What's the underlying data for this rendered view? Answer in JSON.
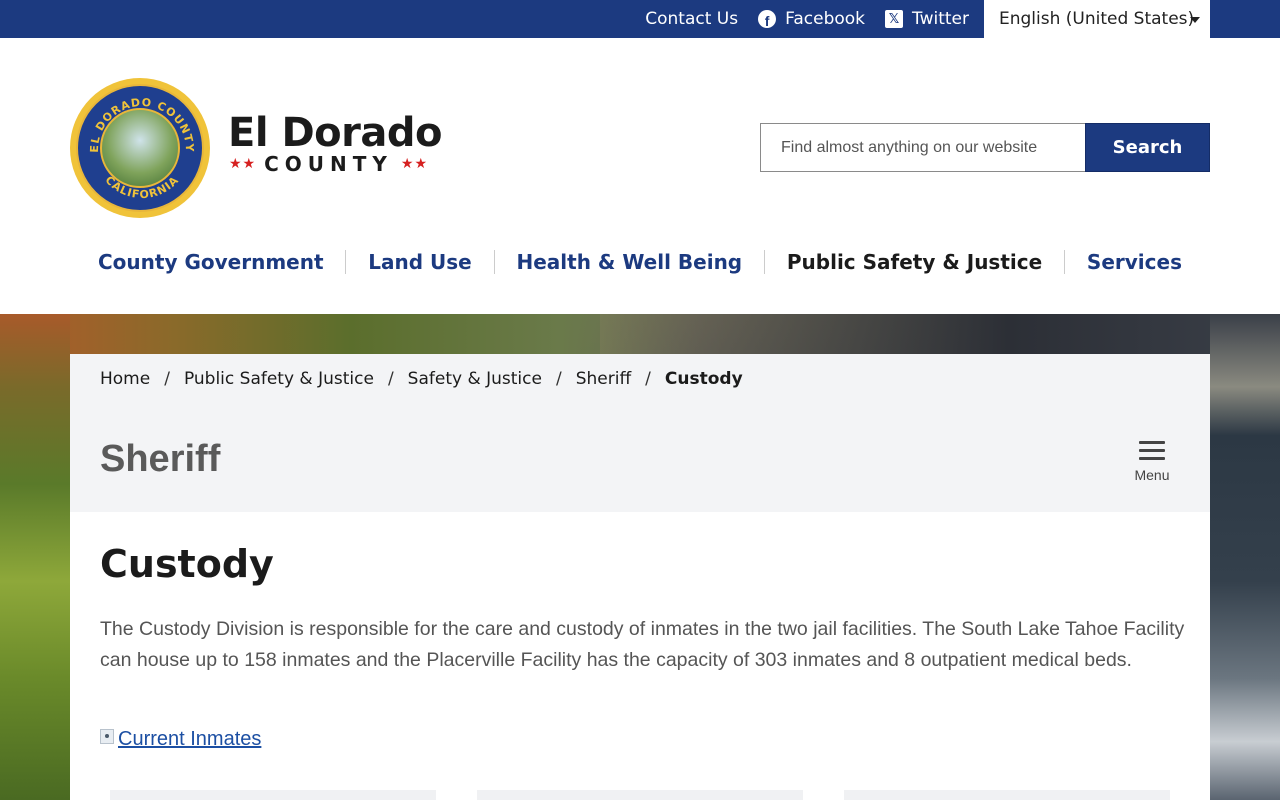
{
  "topbar": {
    "contact_label": "Contact Us",
    "facebook_label": "Facebook",
    "twitter_label": "Twitter",
    "language_selected": "English (United States)"
  },
  "brand": {
    "name": "El Dorado",
    "sub": "COUNTY",
    "seal_top_text": "EL DORADO COUNTY",
    "seal_bottom_text": "CALIFORNIA"
  },
  "search": {
    "placeholder": "Find almost anything on our website",
    "button_label": "Search"
  },
  "nav": {
    "items": [
      {
        "label": "County Government"
      },
      {
        "label": "Land Use"
      },
      {
        "label": "Health & Well Being"
      },
      {
        "label": "Public Safety & Justice"
      },
      {
        "label": "Services"
      }
    ]
  },
  "breadcrumb": {
    "items": [
      "Home",
      "Public Safety & Justice",
      "Safety & Justice",
      "Sheriff"
    ],
    "current": "Custody",
    "separator": "/"
  },
  "section": {
    "title": "Sheriff",
    "menu_label": "Menu"
  },
  "content": {
    "title": "Custody",
    "intro": "The Custody Division is responsible for the care and custody of inmates in the two jail facilities. The South Lake Tahoe Facility can house up to 158 inmates and the Placerville Facility has the capacity of 303 inmates and 8 outpatient medical beds.",
    "link_label": "Current Inmates"
  },
  "colors": {
    "primary": "#1c3a80",
    "text": "#1b1b1b",
    "muted_text": "#555555",
    "link": "#1c4fa3",
    "panel_bg": "#f3f4f6",
    "star_red": "#d62020"
  }
}
